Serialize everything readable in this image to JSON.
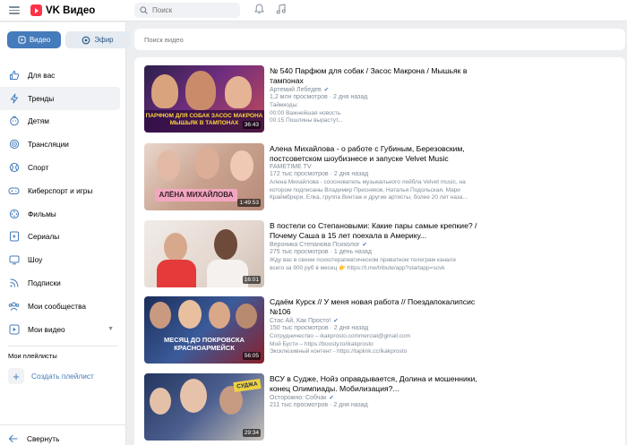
{
  "app": {
    "title": "VK Видео"
  },
  "topbar": {
    "search_placeholder": "Поиск"
  },
  "sidebar": {
    "mode_video": "Видео",
    "mode_live": "Эфир",
    "items": [
      {
        "label": "Для вас",
        "icon": "thumbs-up-icon"
      },
      {
        "label": "Тренды",
        "icon": "lightning-icon"
      },
      {
        "label": "Детям",
        "icon": "kids-icon"
      },
      {
        "label": "Трансляции",
        "icon": "broadcast-icon"
      },
      {
        "label": "Спорт",
        "icon": "ball-icon"
      },
      {
        "label": "Киберспорт и игры",
        "icon": "gamepad-icon"
      },
      {
        "label": "Фильмы",
        "icon": "film-reel-icon"
      },
      {
        "label": "Сериалы",
        "icon": "series-icon"
      },
      {
        "label": "Шоу",
        "icon": "tv-icon"
      },
      {
        "label": "Подписки",
        "icon": "subscriptions-icon"
      },
      {
        "label": "Мои сообщества",
        "icon": "communities-icon"
      },
      {
        "label": "Мои видео",
        "icon": "my-video-icon"
      }
    ],
    "playlists_heading": "Мои плейлисты",
    "create_playlist": "Создать плейлист",
    "collapse": "Свернуть"
  },
  "video_search": {
    "placeholder": "Поиск видео"
  },
  "videos": [
    {
      "title": "№ 540 Парфюм для собак / Засос Макрона / Мышьяк в тампонах",
      "channel": "Артемий Лебедев",
      "meta": "1,2 млн просмотров · 2 дня назад",
      "desc": [
        "Таймкоды:",
        "00:00 Важнейшая новость",
        "00:15 Пошлины вырастут..."
      ],
      "duration": "36:43",
      "thumb_caption": "ПАРФЮМ ДЛЯ СОБАК ЗАСОС МАКРОНА МЫШЬЯК В ТАМПОНАХ"
    },
    {
      "title": "Алена Михайлова - о работе с Губиным, Березовским, постсоветском шоубизнесе и запуске Velvet Music",
      "channel": "FAMETIME TV",
      "meta": "172 тыс просмотров · 2 дня назад",
      "desc": [
        "Алена Михайлова - сооснователь музыкального лейбла Velvet music, на",
        "котором подписаны Владимир Пресняков, Наталья Подольская, Мари",
        "Краймбрери, Елка, группа Винтаж и другие артисты, более 20 лет наза..."
      ],
      "duration": "1:49:53",
      "thumb_caption": "АЛЁНА МИХАЙЛОВА"
    },
    {
      "title": "В постели со Степановыми: Какие пары самые крепкие? / Почему Саша в 15 лет поехала в Америку...",
      "channel": "Вероника Степанова Психолог",
      "meta": "275 тыс просмотров · 1 день назад",
      "desc": [
        "Жду вас в своем психотерапевтическом приватном телеграм канале",
        "всего за 900 руб в месяц 👉 https://t.me/tribute/app?startapp=scvk"
      ],
      "duration": "16:01",
      "thumb_caption": ""
    },
    {
      "title": "Сдаём Курск // У меня новая работа // Поездапокалипсис №106",
      "channel": "Стас Ай, Как Просто!",
      "meta": "150 тыс просмотров · 2 дня назад",
      "desc": [
        "Сотрудничество – ikakprosto.commercial@gmail.com",
        "Мой Бусти – https://boosty.to/ikakprosto",
        "Эксклюзивный контент - https://taplink.cc/ikakprosto"
      ],
      "duration": "56:05",
      "thumb_caption": "МЕСЯЦ ДО ПОКРОВСКА КРАСНОАРМЕЙСК"
    },
    {
      "title": "ВСУ в Судже, Нойз оправдывается, Долина и мошенники, конец Олимпиады. Мобилизация?...",
      "channel": "Осторожно: Собчак",
      "meta": "211 тыс просмотров · 2 дня назад",
      "desc": [],
      "duration": "29:34",
      "thumb_caption": "СУДЖА"
    }
  ],
  "colors": {
    "accent": "#447bba",
    "brand": "#ff3347",
    "bg": "#edeef0"
  }
}
